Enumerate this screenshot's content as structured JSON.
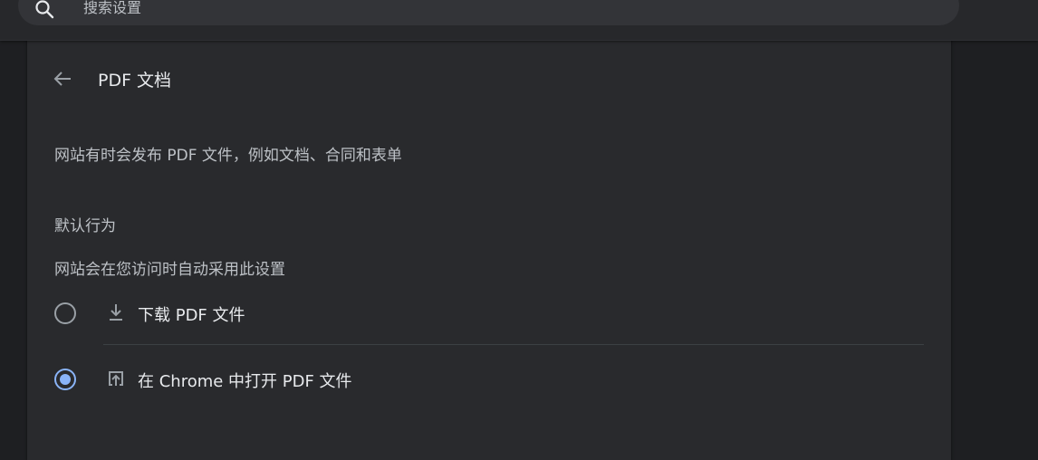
{
  "search": {
    "placeholder": "搜索设置",
    "icon": "search-icon"
  },
  "page": {
    "title": "PDF 文档",
    "back_icon": "back-arrow-icon",
    "description": "网站有时会发布 PDF 文件，例如文档、合同和表单"
  },
  "default_behavior": {
    "title": "默认行为",
    "subtitle": "网站会在您访问时自动采用此设置",
    "options": [
      {
        "label": "下载 PDF 文件",
        "icon": "download-icon",
        "selected": false
      },
      {
        "label": "在 Chrome 中打开 PDF 文件",
        "icon": "open-in-new-icon",
        "selected": true
      }
    ]
  },
  "colors": {
    "background": "#202124",
    "card": "#292a2d",
    "accent": "#8ab4f8",
    "text_primary": "#e8eaed",
    "text_secondary": "#bdc1c6"
  }
}
